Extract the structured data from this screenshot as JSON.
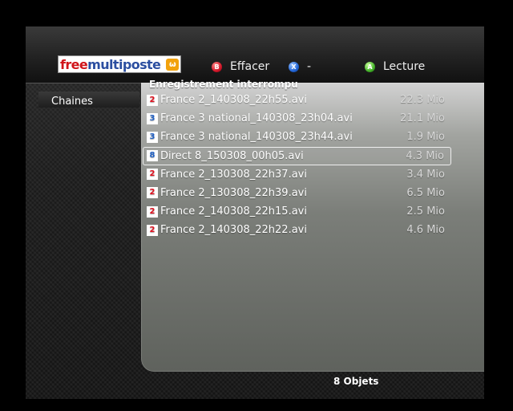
{
  "header": {
    "logo": {
      "part1": "free",
      "part2": "multiposte",
      "badge": "ω"
    },
    "hints": [
      {
        "button": "B",
        "label": "Effacer",
        "color": "#d2182a"
      },
      {
        "button": "X",
        "label": "-",
        "color": "#2266d8"
      },
      {
        "button": "A",
        "label": "Lecture",
        "color": "#44b22a"
      }
    ]
  },
  "sidebar": {
    "items": [
      {
        "label": "Chaines"
      }
    ]
  },
  "main": {
    "title": "Enregistrement interrompu",
    "files": [
      {
        "icon": "france2-logo-icon",
        "name": "France 2_140308_22h55.avi",
        "size": "22.3 Mio"
      },
      {
        "icon": "france3-logo-icon",
        "name": "France 3 national_140308_23h04.avi",
        "size": "21.1 Mio"
      },
      {
        "icon": "france3-logo-icon",
        "name": "France 3 national_140308_23h44.avi",
        "size": "1.9 Mio"
      },
      {
        "icon": "direct8-logo-icon",
        "name": "Direct 8_150308_00h05.avi",
        "size": "4.3 Mio",
        "selected": true
      },
      {
        "icon": "france2-logo-icon",
        "name": "France 2_130308_22h37.avi",
        "size": "3.4 Mio"
      },
      {
        "icon": "france2-logo-icon",
        "name": "France 2_130308_22h39.avi",
        "size": "6.5 Mio"
      },
      {
        "icon": "france2-logo-icon",
        "name": "France 2_140308_22h15.avi",
        "size": "2.5 Mio"
      },
      {
        "icon": "france2-logo-icon",
        "name": "France 2_140308_22h22.avi",
        "size": "4.6 Mio"
      }
    ]
  },
  "footer": {
    "count": "8 Objets"
  }
}
